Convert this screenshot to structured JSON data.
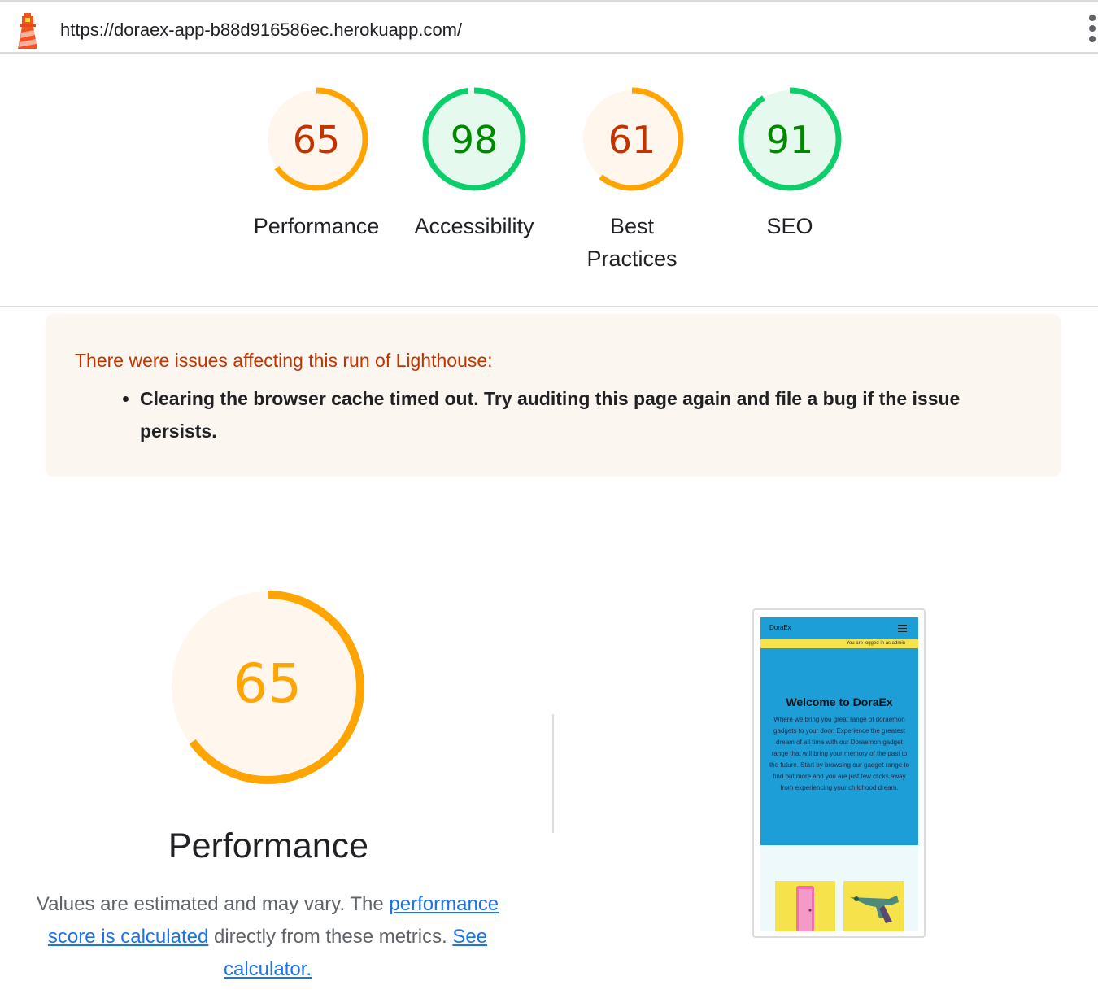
{
  "browser": {
    "url": "https://doraex-app-b88d916586ec.herokuapp.com/"
  },
  "colors": {
    "average": "#ffa400",
    "average_bg": "#fff6ed",
    "average_text": "#c33300",
    "pass": "#0cce6b",
    "pass_bg": "#e6f9ee",
    "pass_text": "#008800",
    "link": "#1a73e8"
  },
  "scores": [
    {
      "label": "Performance",
      "value": "65",
      "fraction": 0.65,
      "rating": "average"
    },
    {
      "label": "Accessibility",
      "value": "98",
      "fraction": 0.98,
      "rating": "pass"
    },
    {
      "label": "Best Practices",
      "value": "61",
      "fraction": 0.61,
      "rating": "average"
    },
    {
      "label": "SEO",
      "value": "91",
      "fraction": 0.91,
      "rating": "pass"
    }
  ],
  "warnings": {
    "title": "There were issues affecting this run of Lighthouse:",
    "items": [
      "Clearing the browser cache timed out. Try auditing this page again and file a bug if the issue persists."
    ]
  },
  "performance": {
    "score": "65",
    "fraction": 0.65,
    "title": "Performance",
    "desc_1": "Values are estimated and may vary. The ",
    "link_1": "performance score is calculated",
    "desc_2": " directly from these metrics. ",
    "link_2": "See calculator."
  },
  "screenshot": {
    "brand": "DoraEx",
    "logged_in": "You are logged in as admin",
    "hero_title": "Welcome to DoraEx",
    "hero_text": "Where we bring you great range of doraemon gadgets to your door. Experience the greatest dream of all time with our Doraemon gadget range that will bring your memory of the past to the future. Start by browsing our gadget range to find out more and you are just few clicks away from experiencing your childhood dream."
  }
}
